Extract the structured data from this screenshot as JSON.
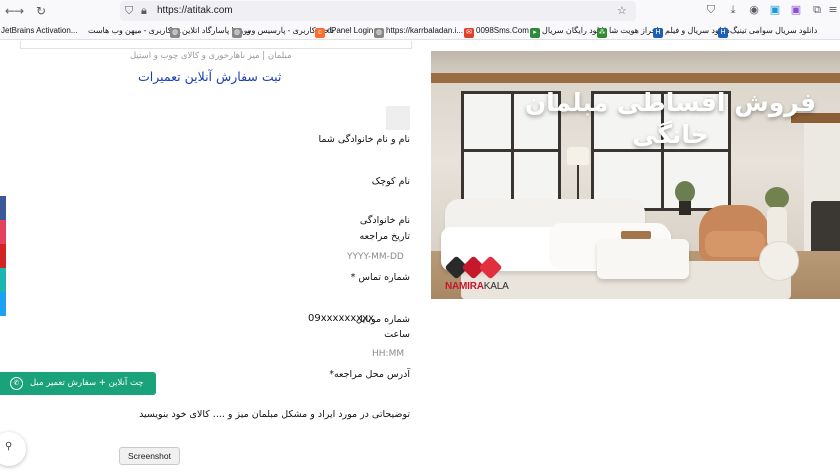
{
  "browser": {
    "url": "https://atitak.com",
    "nav": {
      "back_icon": "arrow-left-icon",
      "forward_icon": "arrow-right-icon",
      "reload_icon": "reload-icon"
    }
  },
  "bookmarks": [
    {
      "label": "JetBrains Activation...",
      "icon": "jetbrains-icon",
      "color": "#000000"
    },
    {
      "label": "ـه کاربری - میهن وب هاست",
      "icon": "page-icon",
      "color": "#888888"
    },
    {
      "label": "ورود | پاسارگاد اتلاین",
      "icon": "globe-icon",
      "color": "#888888"
    },
    {
      "label": "ناحیه کاربری - پارسیس وب",
      "icon": "globe-icon",
      "color": "#888888"
    },
    {
      "label": "cPanel Login",
      "icon": "cpanel-icon",
      "color": "#ff6c2c"
    },
    {
      "label": "https://karrbaladan.i...",
      "icon": "globe-icon",
      "color": "#888888"
    },
    {
      "label": "0098Sms.Com",
      "icon": "sms-icon",
      "color": "#e0402a"
    },
    {
      "label": "دانلود رایگان سریال",
      "icon": "film-icon",
      "color": "#2e8b3c"
    },
    {
      "label": "احراز هویت شا",
      "icon": "network-icon",
      "color": "#2d8a2d"
    },
    {
      "label": "دانلود سریال و فیلم",
      "icon": "h-icon",
      "color": "#1e5fb4"
    },
    {
      "label": "دانلود سریال سوامی تینیگ",
      "icon": "h-icon",
      "color": "#1e5fb4"
    }
  ],
  "page": {
    "breadcrumb": "مبلمان | میز ناهارخوری و کالای چوب و استیل",
    "form_title": "ثبت سفارش آنلاین تعمیرات",
    "fields": {
      "full_name_label": "نام و نام خانوادگی شما",
      "first_name_label": "نام کوچک",
      "last_name_label": "نام خانوادگی",
      "date_label": "تاریخ مراجعه",
      "date_placeholder": "YYYY-MM-DD",
      "contact_label": "شماره تماس *",
      "mobile_label": "شماره موبایل",
      "mobile_value": "09xxxxxxxxx",
      "time_label": "ساعت",
      "time_placeholder": "HH:MM",
      "address_label": "آدرس محل مراجعه*",
      "description_label": "توضیحاتی در مورد ایراد و مشکل مبلمان میز و .... کالای خود بنویسید"
    },
    "hero": {
      "headline_line1": "فروش اقساطی مبلمان",
      "headline_line2": "خانگی",
      "logo_part1": "NAMIRA",
      "logo_part2": "KALA"
    },
    "social_colors": [
      "#3b5998",
      "#e4405f",
      "#d32323",
      "#1ab7b0",
      "#1da1f2"
    ],
    "whatsapp_button": "چت آنلاین + سفارش تعمیر مبل",
    "tooltip": "Screenshot"
  }
}
